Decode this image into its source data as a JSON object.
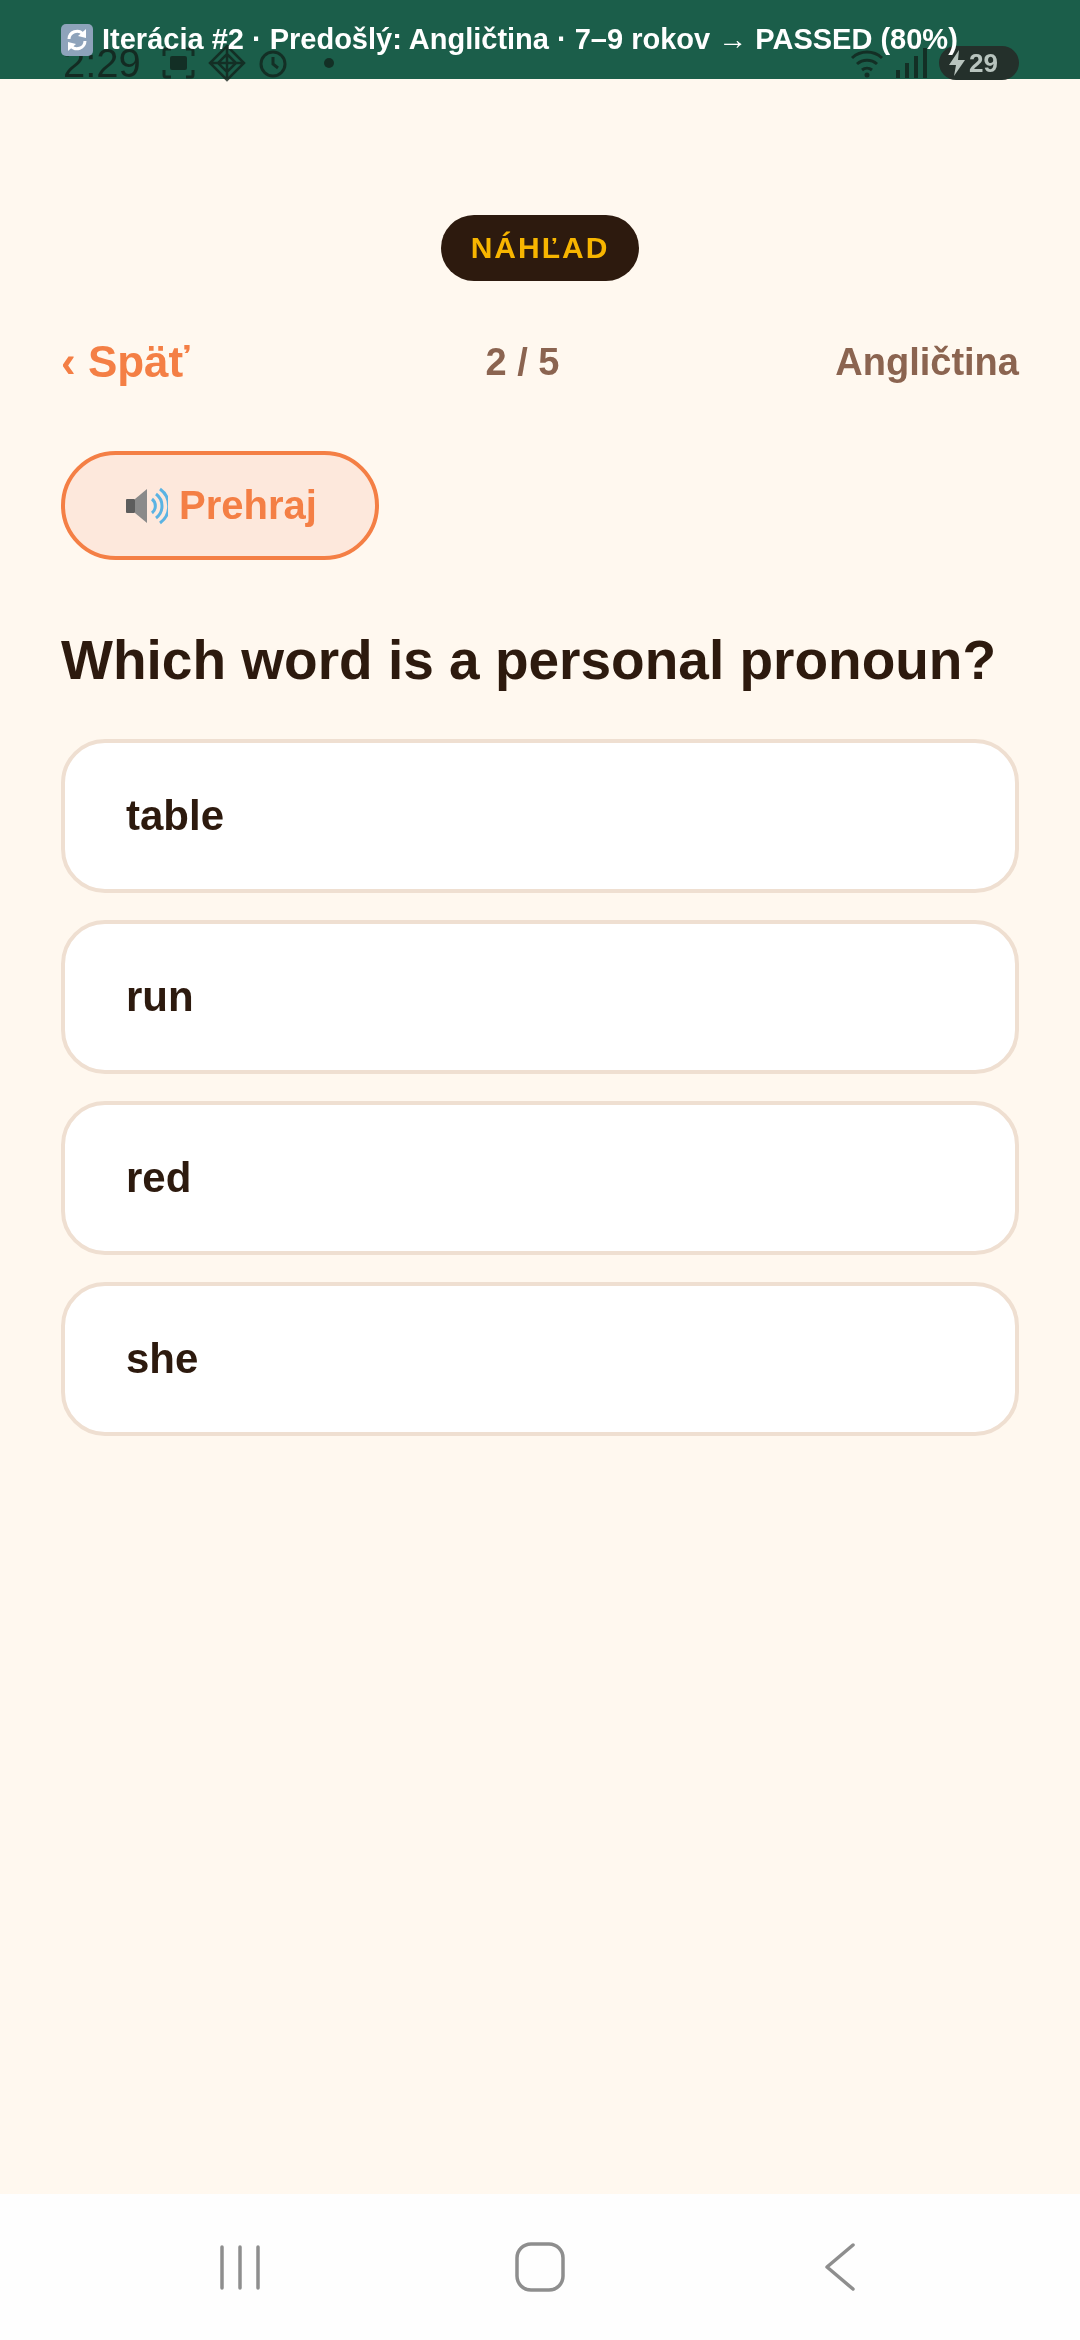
{
  "banner": {
    "text": "Iterácia #2 · Predošlý: Angličtina · 7–9 rokov → PASSED (80%)"
  },
  "status_bar": {
    "time": "2:29",
    "battery": "29"
  },
  "badge": "NÁHĽAD",
  "header": {
    "back": "‹ Späť",
    "progress": "2 / 5",
    "subject": "Angličtina"
  },
  "play_button": {
    "label": "Prehraj"
  },
  "question": "Which word is a personal pronoun?",
  "options": [
    {
      "label": "table",
      "selected": false
    },
    {
      "label": "run",
      "selected": false
    },
    {
      "label": "red",
      "selected": false
    },
    {
      "label": "she",
      "selected": false
    }
  ]
}
